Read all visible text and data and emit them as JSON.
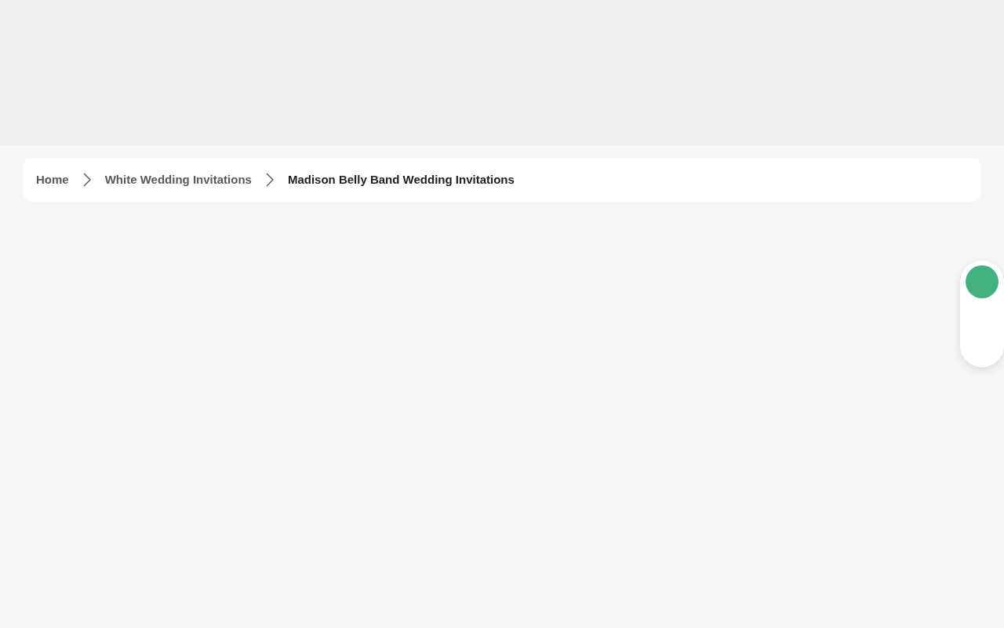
{
  "breadcrumb": [
    {
      "label": "Home",
      "current": false
    },
    {
      "label": "White Wedding Invitations",
      "current": false
    },
    {
      "label": "Madison Belly Band Wedding Invitations",
      "current": true
    }
  ]
}
